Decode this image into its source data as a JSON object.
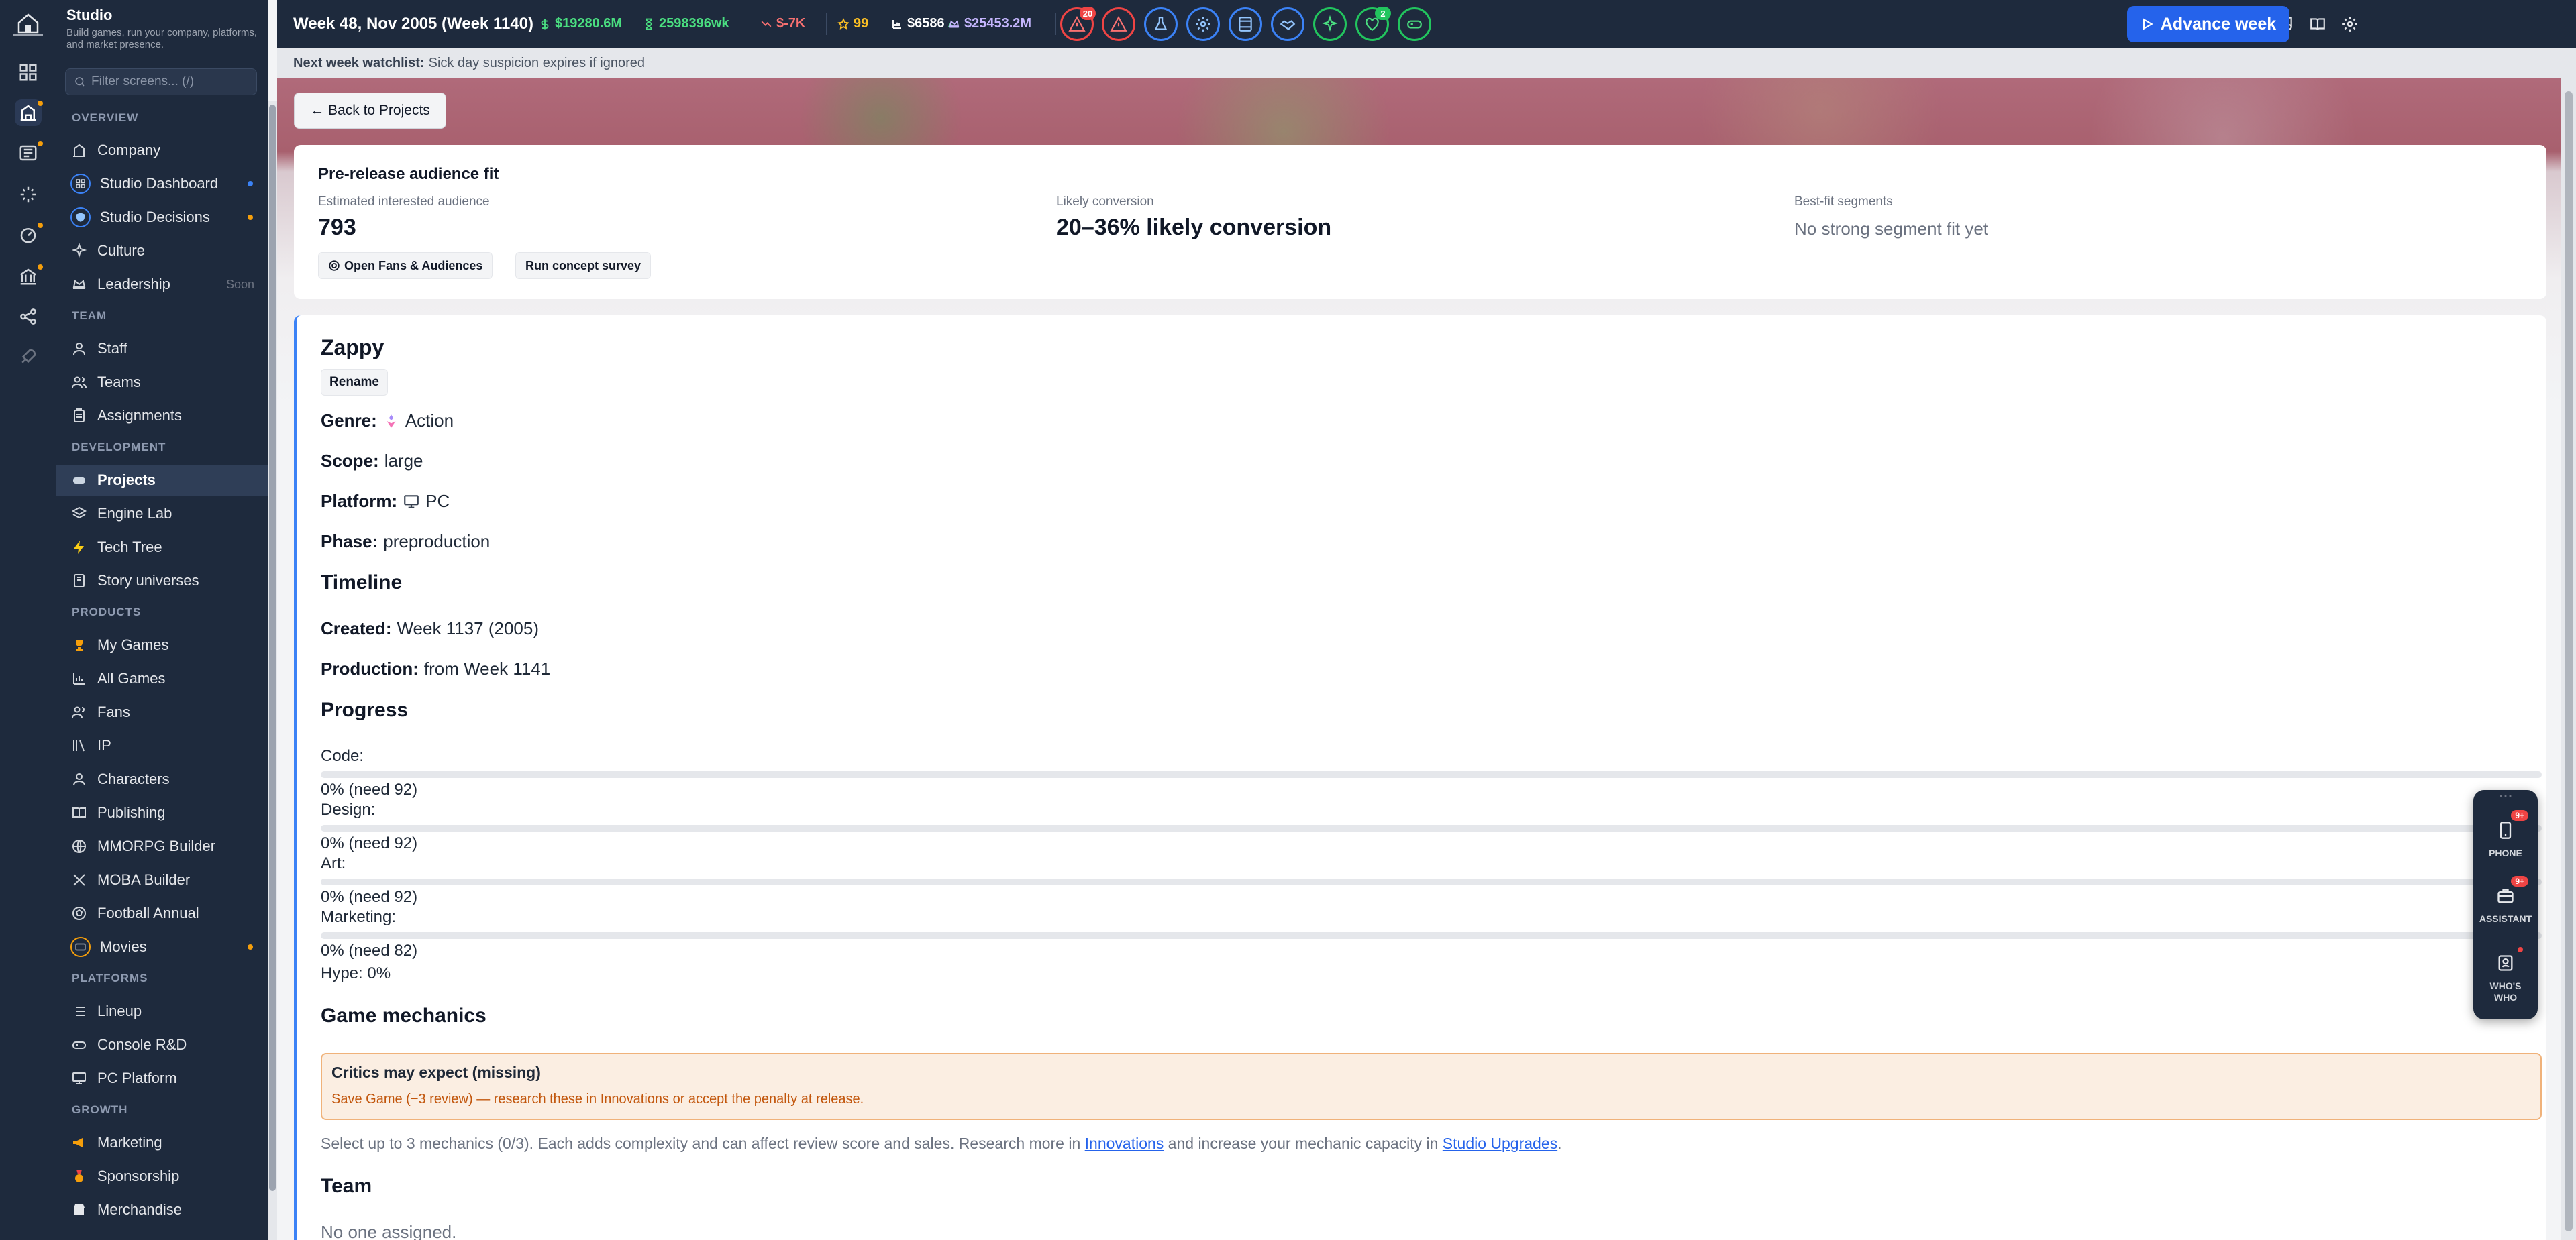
{
  "topbar": {
    "week": "Week 48, Nov 2005 (Week 1140)",
    "cash": "$19280.6M",
    "weekly": "2598396wk",
    "delta": "$-7K",
    "stars": "99",
    "price": "$6586",
    "value": "$25453.2M",
    "alert_badge": "20",
    "heart_badge": "2",
    "advance_label": "Advance week"
  },
  "watchlist": {
    "label": "Next week watchlist:",
    "text": "Sick day suspicion expires if ignored"
  },
  "sidebar": {
    "title": "Studio",
    "subtitle": "Build games, run your company, platforms, and market presence.",
    "filter_placeholder": "Filter screens... (/)",
    "sections": {
      "overview": "OVERVIEW",
      "team": "TEAM",
      "development": "DEVELOPMENT",
      "products": "PRODUCTS",
      "platforms": "PLATFORMS",
      "growth": "GROWTH"
    },
    "items": {
      "company": "Company",
      "studio_dashboard": "Studio Dashboard",
      "studio_decisions": "Studio Decisions",
      "culture": "Culture",
      "leadership": "Leadership",
      "leadership_soon": "Soon",
      "staff": "Staff",
      "teams": "Teams",
      "assignments": "Assignments",
      "projects": "Projects",
      "engine_lab": "Engine Lab",
      "tech_tree": "Tech Tree",
      "story_universes": "Story universes",
      "my_games": "My Games",
      "all_games": "All Games",
      "fans": "Fans",
      "ip": "IP",
      "characters": "Characters",
      "publishing": "Publishing",
      "mmorpg_builder": "MMORPG Builder",
      "moba_builder": "MOBA Builder",
      "football_annual": "Football Annual",
      "movies": "Movies",
      "lineup": "Lineup",
      "console_rd": "Console R&D",
      "pc_platform": "PC Platform",
      "marketing": "Marketing",
      "sponsorship": "Sponsorship",
      "merchandise": "Merchandise"
    }
  },
  "main": {
    "back_label": "← Back to Projects",
    "audience": {
      "title": "Pre-release audience fit",
      "est_label": "Estimated interested audience",
      "est_value": "793",
      "conv_label": "Likely conversion",
      "conv_value": "20–36% likely conversion",
      "seg_label": "Best-fit segments",
      "seg_value": "No strong segment fit yet",
      "open_fans_label": "Open Fans & Audiences",
      "survey_label": "Run concept survey"
    },
    "project": {
      "name": "Zappy",
      "rename_label": "Rename",
      "genre_key": "Genre:",
      "genre_value": "Action",
      "scope_key": "Scope:",
      "scope_value": "large",
      "platform_key": "Platform:",
      "platform_value": "PC",
      "phase_key": "Phase:",
      "phase_value": "preproduction",
      "timeline_heading": "Timeline",
      "created_key": "Created:",
      "created_value": "Week 1137 (2005)",
      "production_key": "Production:",
      "production_value": "from Week 1141",
      "progress_heading": "Progress",
      "progress": [
        {
          "label": "Code:",
          "value": "0% (need 92)",
          "fraction": 0
        },
        {
          "label": "Design:",
          "value": "0% (need 92)",
          "fraction": 0
        },
        {
          "label": "Art:",
          "value": "0% (need 92)",
          "fraction": 0
        },
        {
          "label": "Marketing:",
          "value": "0% (need 82)",
          "fraction": 0
        }
      ],
      "hype": "Hype: 0%",
      "mechanics_heading": "Game mechanics",
      "warn_title": "Critics may expect (missing)",
      "warn_text": "Save Game (−3 review) — research these in Innovations or accept the penalty at release.",
      "mech_text_1": "Select up to 3 mechanics (0/3). Each adds complexity and can affect review score and sales. Research more in ",
      "mech_link_1": "Innovations",
      "mech_text_2": " and increase your mechanic capacity in ",
      "mech_link_2": "Studio Upgrades",
      "mech_text_3": ".",
      "team_heading": "Team",
      "team_value": "No one assigned."
    }
  },
  "dock": {
    "phone_label": "PHONE",
    "phone_badge": "9+",
    "assistant_label": "ASSISTANT",
    "assistant_badge": "9+",
    "whoswho_label": "WHO'S WHO"
  },
  "colors": {
    "nav_bg": "#1e2a3d",
    "accent": "#2563eb",
    "green": "#22c55e",
    "red": "#ef4444",
    "amber": "#f59e0b",
    "purple": "#a78bfa"
  }
}
